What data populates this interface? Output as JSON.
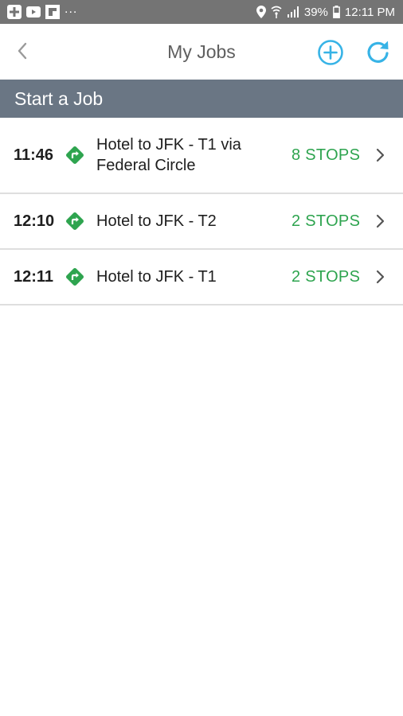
{
  "status_bar": {
    "left_icons": [
      "app-notification-icon",
      "youtube-icon",
      "flipboard-icon"
    ],
    "overflow": "...",
    "right_icons": [
      "location-icon",
      "wifi-icon",
      "signal-icon",
      "battery-icon"
    ],
    "battery": "39%",
    "time": "12:11 PM"
  },
  "header": {
    "title": "My Jobs",
    "back_icon": "chevron-left-icon",
    "add_icon": "add-circle-icon",
    "refresh_icon": "refresh-icon",
    "accent_color": "#37b3e6"
  },
  "section": {
    "title": "Start a Job",
    "background": "#6a7684"
  },
  "jobs": [
    {
      "time": "11:46",
      "name": "Hotel to JFK - T1 via Federal Circle",
      "stops": "8 STOPS"
    },
    {
      "time": "12:10",
      "name": "Hotel to JFK - T2",
      "stops": "2 STOPS"
    },
    {
      "time": "12:11",
      "name": "Hotel to JFK - T1",
      "stops": "2 STOPS"
    }
  ],
  "colors": {
    "stops": "#2ea44f",
    "route_icon": "#2ea44f",
    "status_bar": "#747474"
  }
}
